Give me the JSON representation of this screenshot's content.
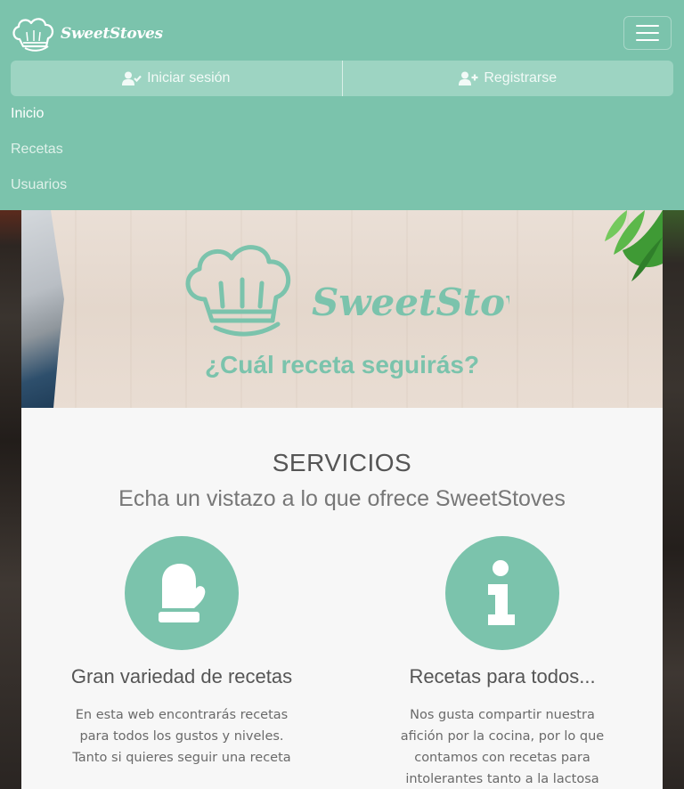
{
  "brand": {
    "name": "SweetStoves"
  },
  "navbar": {
    "toggler_icon": "hamburger-icon",
    "auth": {
      "login_label": "Iniciar sesión",
      "login_icon": "user-check-icon",
      "register_label": "Registrarse",
      "register_icon": "user-plus-icon"
    },
    "links": [
      {
        "label": "Inicio",
        "active": true
      },
      {
        "label": "Recetas",
        "active": false
      },
      {
        "label": "Usuarios",
        "active": false
      }
    ]
  },
  "hero": {
    "logo_text": "SweetStoves",
    "title": "¿Cuál receta seguirás?"
  },
  "services": {
    "title": "SERVICIOS",
    "subtitle": "Echa un vistazo a lo que ofrece SweetStoves",
    "items": [
      {
        "icon": "oven-mitt-icon",
        "heading": "Gran variedad de recetas",
        "text": "En esta web encontrarás recetas para todos los gustos y niveles. Tanto si quieres seguir una receta"
      },
      {
        "icon": "info-icon",
        "heading": "Recetas para todos...",
        "text": "Nos gusta compartir nuestra afición por la cocina, por lo que contamos con recetas para intolerantes tanto a la lactosa"
      }
    ]
  },
  "colors": {
    "accent": "#7bc3ac",
    "nav_button": "#9dd4c2",
    "heading_text": "#555555",
    "body_text": "#6a6a6a"
  }
}
